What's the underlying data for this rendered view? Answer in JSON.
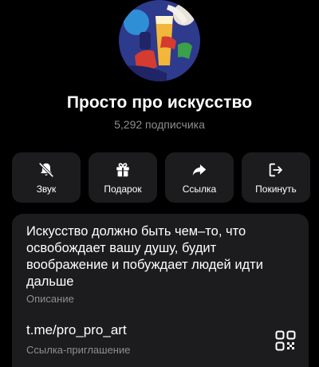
{
  "channel": {
    "title": "Просто про искусство",
    "subscribers": "5,292 подписчика"
  },
  "actions": [
    {
      "label": "Звук",
      "icon": "bell-off-icon"
    },
    {
      "label": "Подарок",
      "icon": "gift-icon"
    },
    {
      "label": "Ссылка",
      "icon": "share-arrow-icon"
    },
    {
      "label": "Покинуть",
      "icon": "leave-icon"
    }
  ],
  "info": {
    "description": "Искусство должно быть чем–то, что освобождает вашу душу, будит воображение и побуждает людей идти дальше",
    "description_caption": "Описание",
    "link": "t.me/pro_pro_art",
    "link_caption": "Ссылка-приглашение"
  },
  "colors": {
    "background": "#000000",
    "card": "#1c1c1e",
    "secondary_text": "#8e8e93"
  }
}
